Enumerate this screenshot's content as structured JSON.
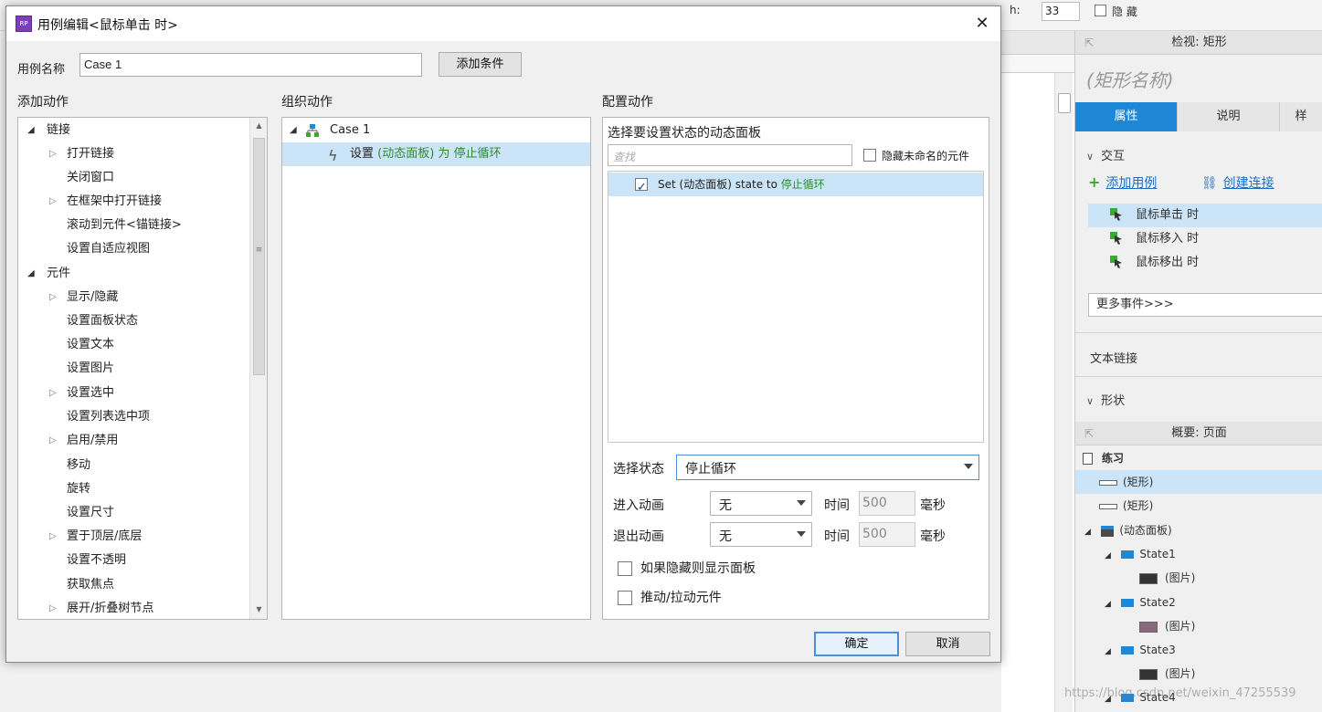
{
  "dialog": {
    "title": "用例编辑<鼠标单击 时>",
    "app_icon_text": "RP",
    "case_name_label": "用例名称",
    "case_name_value": "Case 1",
    "add_condition_button": "添加条件",
    "ok_button": "确定",
    "cancel_button": "取消"
  },
  "add_action": {
    "title": "添加动作",
    "items": [
      {
        "label": "链接",
        "kind": "group",
        "expanded": true
      },
      {
        "label": "打开链接",
        "kind": "expandable"
      },
      {
        "label": "关闭窗口",
        "kind": "leaf"
      },
      {
        "label": "在框架中打开链接",
        "kind": "expandable"
      },
      {
        "label": "滚动到元件<锚链接>",
        "kind": "leaf"
      },
      {
        "label": "设置自适应视图",
        "kind": "leaf"
      },
      {
        "label": "元件",
        "kind": "group",
        "expanded": true
      },
      {
        "label": "显示/隐藏",
        "kind": "expandable"
      },
      {
        "label": "设置面板状态",
        "kind": "leaf"
      },
      {
        "label": "设置文本",
        "kind": "leaf"
      },
      {
        "label": "设置图片",
        "kind": "leaf"
      },
      {
        "label": "设置选中",
        "kind": "expandable"
      },
      {
        "label": "设置列表选中项",
        "kind": "leaf"
      },
      {
        "label": "启用/禁用",
        "kind": "expandable"
      },
      {
        "label": "移动",
        "kind": "leaf"
      },
      {
        "label": "旋转",
        "kind": "leaf"
      },
      {
        "label": "设置尺寸",
        "kind": "leaf"
      },
      {
        "label": "置于顶层/底层",
        "kind": "expandable"
      },
      {
        "label": "设置不透明",
        "kind": "leaf"
      },
      {
        "label": "获取焦点",
        "kind": "leaf"
      },
      {
        "label": "展开/折叠树节点",
        "kind": "expandable"
      }
    ]
  },
  "organize_action": {
    "title": "组织动作",
    "case_label": "Case 1",
    "action_prefix": "设置 ",
    "action_target": "(动态面板) 为 停止循环"
  },
  "configure_action": {
    "title": "配置动作",
    "subtitle": "选择要设置状态的动态面板",
    "search_placeholder": "查找",
    "hide_unnamed_label": "隐藏未命名的元件",
    "panel_row_prefix": "Set (动态面板) state to ",
    "panel_row_state": "停止循环",
    "select_state_label": "选择状态",
    "select_state_value": "停止循环",
    "enter_anim_label": "进入动画",
    "exit_anim_label": "退出动画",
    "anim_value": "无",
    "time_label": "时间",
    "time_value": "500",
    "ms_label": "毫秒",
    "show_if_hidden_label": "如果隐藏则显示面板",
    "push_pull_label": "推动/拉动元件"
  },
  "background": {
    "h_label": "h:",
    "h_value": "33",
    "hide_label": "隐 藏",
    "inspector": {
      "header": "检视: 矩形",
      "shape_name": "(矩形名称)",
      "tabs": [
        "属性",
        "说明",
        "样"
      ],
      "interaction_title": "交互",
      "add_case": "添加用例",
      "create_link": "创建连接",
      "events": [
        "鼠标单击 时",
        "鼠标移入 时",
        "鼠标移出 时"
      ],
      "more_events": "更多事件>>>",
      "text_link": "文本链接",
      "shape_section": "形状"
    },
    "outline": {
      "header": "概要: 页面",
      "page_name": "练习",
      "items": [
        "(矩形)",
        "(矩形)",
        "(动态面板)",
        "State1",
        "(图片)",
        "State2",
        "(图片)",
        "State3",
        "(图片)",
        "State4"
      ]
    },
    "watermark": "https://blog.csdn.net/weixin_47255539"
  },
  "colors": {
    "accent": "#1e88d6",
    "selection": "#cce4f7",
    "green_text": "#2e8b2e",
    "link": "#1e6fc0"
  }
}
